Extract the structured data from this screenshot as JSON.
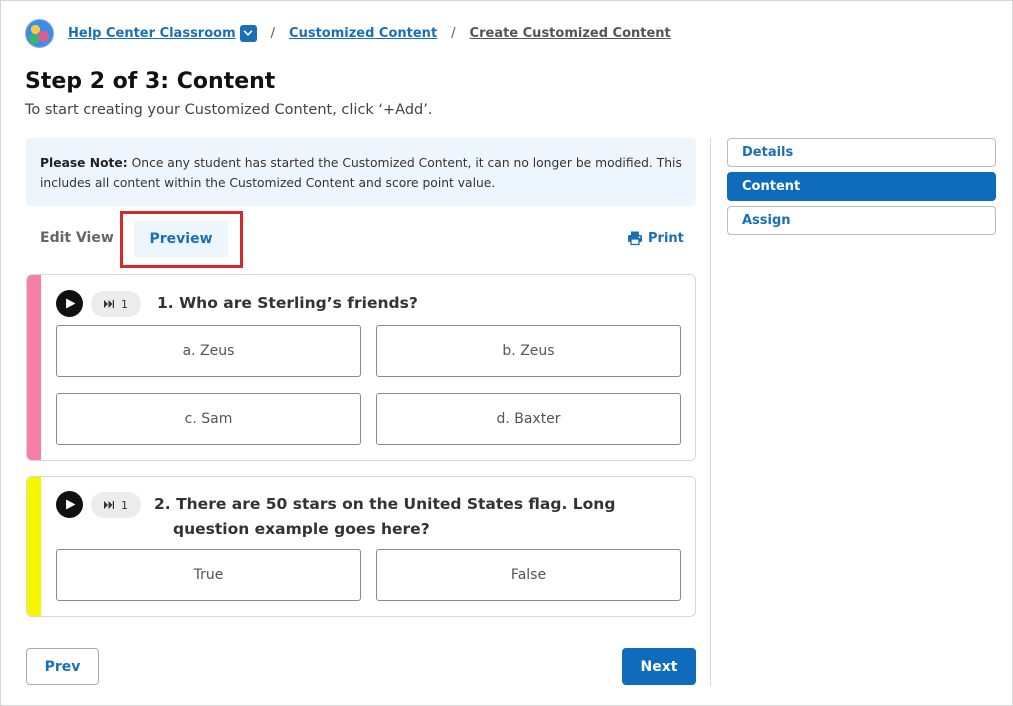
{
  "breadcrumb": {
    "logo_icon": "classroom-globe-icon",
    "classroom": "Help Center Classroom",
    "dropdown_icon": "chevron-down-icon",
    "separator": "/",
    "section": "Customized Content",
    "current": "Create Customized Content"
  },
  "page": {
    "title": "Step 2 of 3: Content",
    "subtitle": "To start creating your Customized Content, click ‘+Add’."
  },
  "note": {
    "label": "Please Note:",
    "text": " Once any student has started the Customized Content, it can no longer be modified.  This includes all content within the Customized Content and score point value."
  },
  "tabs": {
    "edit": "Edit View",
    "preview": "Preview",
    "print": "Print",
    "print_icon": "printer-icon"
  },
  "questions": [
    {
      "bar_color": "#f77fa6",
      "speed": "1",
      "text_line1": "1. Who are Sterling’s friends?",
      "answers": [
        "a. Zeus",
        "b. Zeus",
        "c. Sam",
        "d. Baxter"
      ]
    },
    {
      "bar_color": "#f6f600",
      "speed": "1",
      "text_line1": "2. There are 50 stars on the United States flag. Long",
      "text_line2": "question example goes here?",
      "answers": [
        "True",
        "False"
      ]
    }
  ],
  "steps": [
    "Details",
    "Content",
    "Assign"
  ],
  "active_step": "Content",
  "buttons": {
    "prev": "Prev",
    "next": "Next"
  },
  "colors": {
    "primary": "#0f6cbd",
    "link": "#1a6fb5",
    "note_bg": "#eef6fd",
    "highlight": "#d42a2a"
  }
}
